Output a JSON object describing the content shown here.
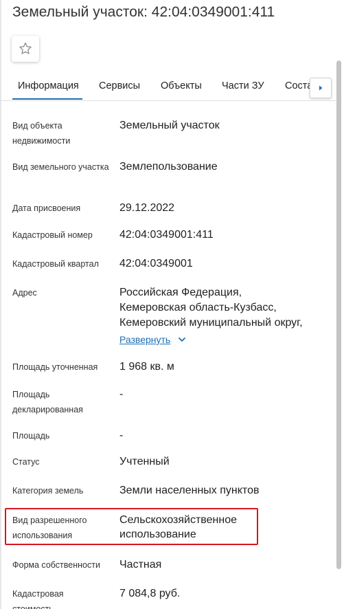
{
  "header": {
    "title": "Земельный участок: 42:04:0349001:411"
  },
  "tabs": [
    {
      "label": "Информация",
      "active": true
    },
    {
      "label": "Сервисы"
    },
    {
      "label": "Объекты"
    },
    {
      "label": "Части ЗУ"
    },
    {
      "label": "Соста"
    }
  ],
  "details": {
    "object_type": {
      "label": "Вид объекта недвижимости",
      "value": "Земельный участок"
    },
    "land_type": {
      "label": "Вид земельного участка",
      "value": "Землепользование"
    },
    "assign_date": {
      "label": "Дата присвоения",
      "value": "29.12.2022"
    },
    "cadastral_number": {
      "label": "Кадастровый номер",
      "value": "42:04:0349001:411"
    },
    "cadastral_quarter": {
      "label": "Кадастровый квартал",
      "value": "42:04:0349001"
    },
    "address": {
      "label": "Адрес",
      "lines": [
        "Российская Федерация,",
        "Кемеровская область-Кузбасс,",
        "Кемеровский муниципальный округ,"
      ],
      "expand_label": "Развернуть"
    },
    "area_specified": {
      "label": "Площадь уточненная",
      "value": "1 968 кв. м"
    },
    "area_declared": {
      "label": "Площадь декларированная",
      "value": "-"
    },
    "area": {
      "label": "Площадь",
      "value": "-"
    },
    "status": {
      "label": "Статус",
      "value": "Учтенный"
    },
    "land_category": {
      "label": "Категория земель",
      "value": "Земли населенных пунктов"
    },
    "permitted_use": {
      "label": "Вид разрешенного использования",
      "value": "Сельскохозяйственное использование"
    },
    "ownership": {
      "label": "Форма собственности",
      "value": "Частная"
    },
    "cadastral_value": {
      "label": "Кадастровая стоимость",
      "value": "7 084,8 руб."
    }
  },
  "colors": {
    "accent": "#1f6fb3",
    "highlight": "#d9141f",
    "link": "#1a6fb5"
  },
  "icons": {
    "favorite": "star-outline-icon",
    "tab_scroll": "triangle-right-icon",
    "expand": "chevron-down-icon"
  }
}
